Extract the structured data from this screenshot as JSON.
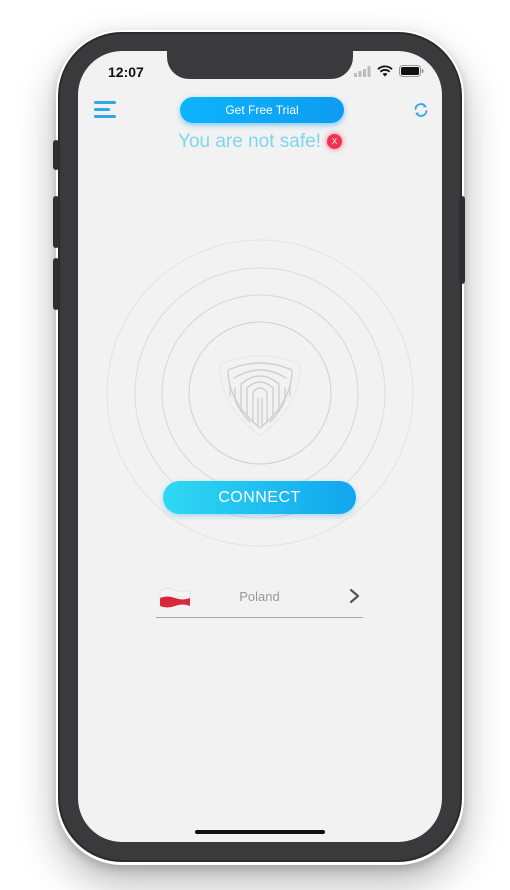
{
  "status_bar": {
    "time": "12:07"
  },
  "header": {
    "trial_button_label": "Get Free Trial",
    "menu_icon": "hamburger-menu-icon",
    "refresh_icon": "refresh-icon"
  },
  "warning": {
    "text": "You are not safe!",
    "close_label": "X"
  },
  "main": {
    "center_icon": "fingerprint-shield-icon",
    "connect_label": "CONNECT"
  },
  "location": {
    "country": "Poland",
    "flag_icon": "poland-flag-icon",
    "chevron_icon": "chevron-right-icon"
  },
  "colors": {
    "accent": "#0da9f5",
    "warning_text": "#7ed6ee",
    "danger": "#f0314f",
    "background": "#f2f2f3"
  }
}
